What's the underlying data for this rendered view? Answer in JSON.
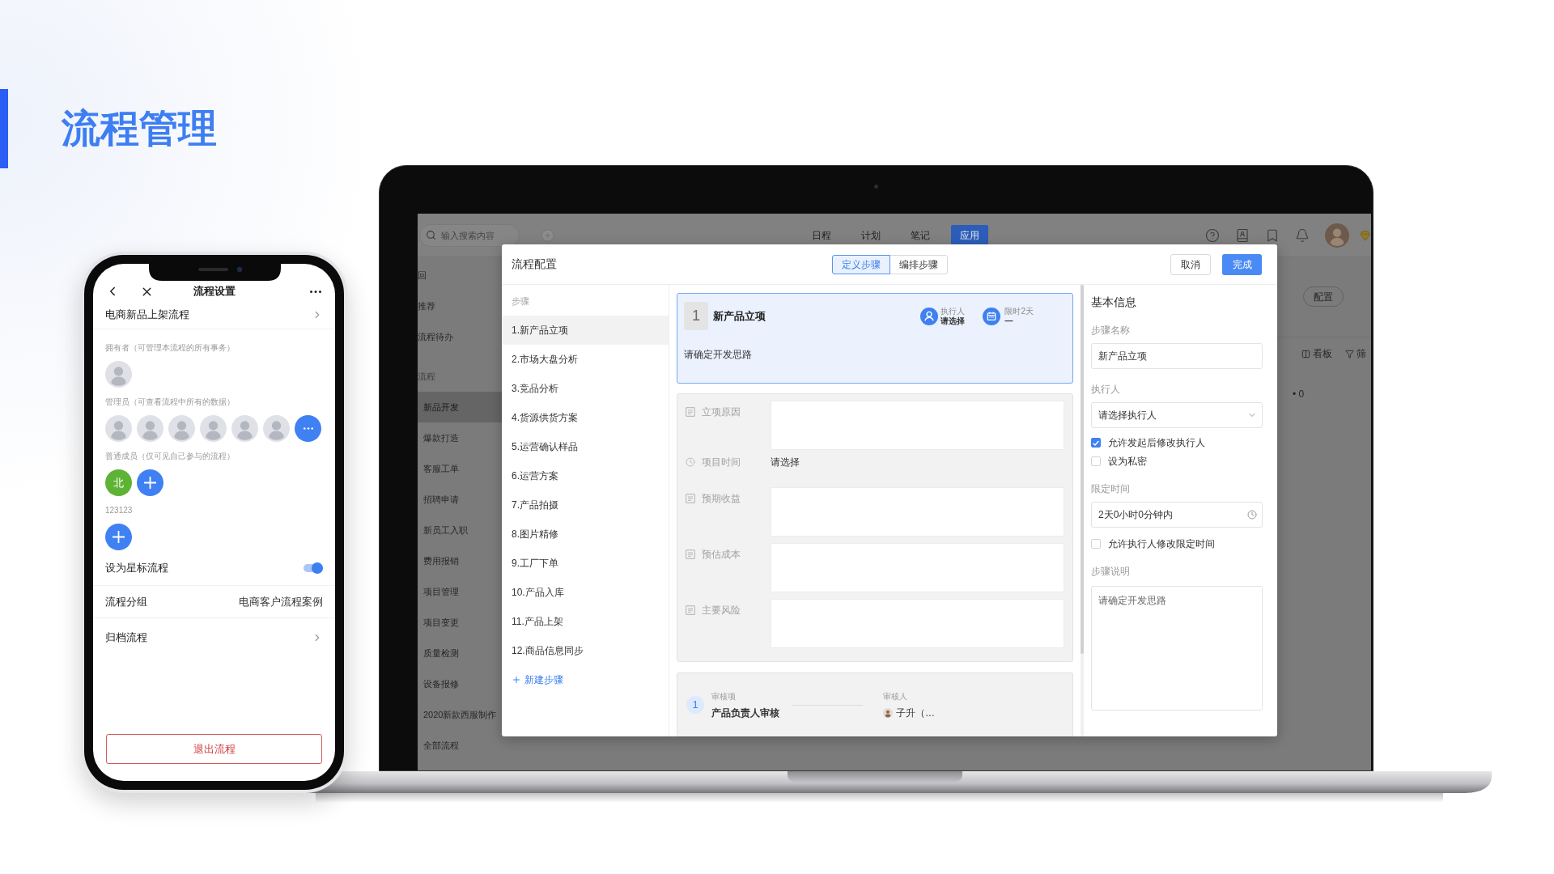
{
  "page": {
    "title": "流程管理"
  },
  "phone": {
    "title": "流程设置",
    "flow_name": "电商新品上架流程",
    "groups": [
      {
        "label": "拥有者（可管理本流程的所有事务）",
        "members": [
          {
            "kind": "photo"
          }
        ]
      },
      {
        "label": "管理员（可查看流程中所有的数据）",
        "members": [
          {
            "kind": "photo"
          },
          {
            "kind": "photo"
          },
          {
            "kind": "photo"
          },
          {
            "kind": "photo"
          },
          {
            "kind": "photo"
          },
          {
            "kind": "photo"
          },
          {
            "kind": "more"
          }
        ]
      },
      {
        "label": "普通成员（仅可见自己参与的流程）",
        "members": [
          {
            "kind": "initial",
            "text": "北"
          },
          {
            "kind": "add"
          }
        ]
      },
      {
        "label": "123123",
        "members": [
          {
            "kind": "add"
          }
        ]
      }
    ],
    "star": {
      "label": "设为星标流程",
      "on": true
    },
    "group_row": {
      "label": "流程分组",
      "value": "电商客户流程案例"
    },
    "archive": {
      "label": "归档流程"
    },
    "exit_button": "退出流程"
  },
  "laptop": {
    "app": {
      "search": {
        "placeholder": "输入搜索内容"
      },
      "nav": [
        {
          "label": "日程",
          "selected": false
        },
        {
          "label": "计划",
          "selected": false
        },
        {
          "label": "笔记",
          "selected": false
        },
        {
          "label": "应用",
          "selected": true
        }
      ],
      "sidebar": {
        "back": "回",
        "links": [
          "推荐",
          "流程待办"
        ],
        "section": "流程",
        "flows": [
          {
            "label": "新品开发",
            "selected": true
          },
          {
            "label": "爆款打造",
            "selected": false
          },
          {
            "label": "客服工单",
            "selected": false
          },
          {
            "label": "招聘申请",
            "selected": false
          },
          {
            "label": "新员工入职",
            "selected": false
          },
          {
            "label": "费用报销",
            "selected": false
          },
          {
            "label": "项目管理",
            "selected": false
          },
          {
            "label": "项目变更",
            "selected": false
          },
          {
            "label": "质量检测",
            "selected": false
          },
          {
            "label": "设备报修",
            "selected": false
          },
          {
            "label": "2020新款西服制作",
            "selected": false
          },
          {
            "label": "全部流程",
            "selected": false
          }
        ]
      },
      "content": {
        "config_button": "配置",
        "views": [
          {
            "kind": "board",
            "label": "看板"
          },
          {
            "kind": "filter",
            "label": "筛"
          }
        ],
        "count": "• 0"
      }
    },
    "modal": {
      "title": "流程配置",
      "tabs": [
        {
          "label": "定义步骤",
          "selected": true
        },
        {
          "label": "编排步骤",
          "selected": false
        }
      ],
      "actions": [
        {
          "kind": "cancel",
          "label": "取消"
        },
        {
          "kind": "confirm",
          "label": "完成"
        }
      ],
      "steps": {
        "heading": "步骤",
        "items": [
          {
            "label": "1.新产品立项",
            "selected": true
          },
          {
            "label": "2.市场大盘分析",
            "selected": false
          },
          {
            "label": "3.竞品分析",
            "selected": false
          },
          {
            "label": "4.货源供货方案",
            "selected": false
          },
          {
            "label": "5.运营确认样品",
            "selected": false
          },
          {
            "label": "6.运营方案",
            "selected": false
          },
          {
            "label": "7.产品拍摄",
            "selected": false
          },
          {
            "label": "8.图片精修",
            "selected": false
          },
          {
            "label": "9.工厂下单",
            "selected": false
          },
          {
            "label": "10.产品入库",
            "selected": false
          },
          {
            "label": "11.产品上架",
            "selected": false
          },
          {
            "label": "12.商品信息同步",
            "selected": false
          }
        ],
        "add": "新建步骤"
      },
      "step_card": {
        "number": "1",
        "title": "新产品立项",
        "executor": {
          "label": "执行人",
          "value": "请选择"
        },
        "deadline": {
          "label": "限时2天",
          "value": "—"
        },
        "description": "请确定开发思路"
      },
      "fields": [
        {
          "kind": "text",
          "label": "立项原因"
        },
        {
          "kind": "time",
          "label": "项目时间",
          "value": "请选择"
        },
        {
          "kind": "text",
          "label": "预期收益"
        },
        {
          "kind": "text",
          "label": "预估成本"
        },
        {
          "kind": "text",
          "label": "主要风险"
        }
      ],
      "review": {
        "number": "1",
        "item_label": "审核项",
        "item": "产品负责人审核",
        "reviewer_label": "审核人",
        "reviewer": "子升（…"
      },
      "info": {
        "heading": "基本信息",
        "name": {
          "label": "步骤名称",
          "value": "新产品立项"
        },
        "executor": {
          "label": "执行人",
          "placeholder": "请选择执行人"
        },
        "executor_options": [
          {
            "label": "允许发起后修改执行人",
            "checked": true
          },
          {
            "label": "设为私密",
            "checked": false
          }
        ],
        "time": {
          "label": "限定时间",
          "value": "2天0小时0分钟内"
        },
        "time_options": [
          {
            "label": "允许执行人修改限定时间",
            "checked": false
          }
        ],
        "description": {
          "label": "步骤说明",
          "value": "请确定开发思路"
        }
      }
    }
  }
}
